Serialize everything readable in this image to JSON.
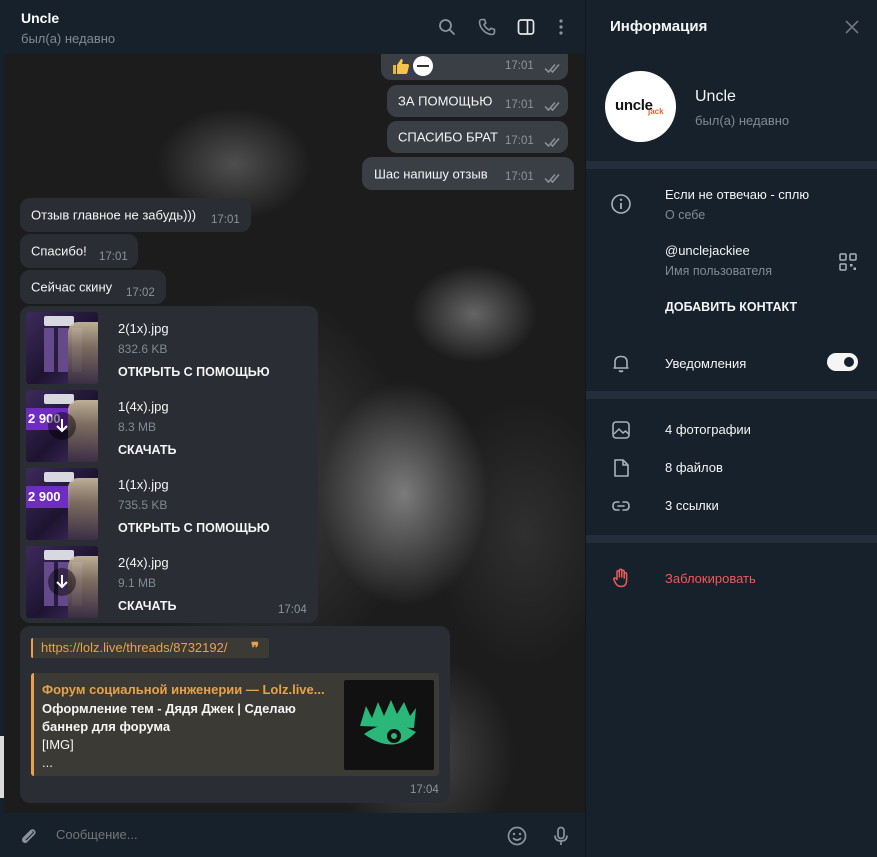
{
  "header": {
    "title": "Uncle",
    "status": "был(а) недавно"
  },
  "messages": {
    "outgoing": [
      {
        "text": "",
        "time": "17:01"
      },
      {
        "text": "ЗА ПОМОЩЬЮ",
        "time": "17:01"
      },
      {
        "text": "СПАСИБО БРАТ",
        "time": "17:01"
      },
      {
        "text": "Шас напишу отзыв",
        "time": "17:01"
      }
    ],
    "incoming": [
      {
        "text": "Отзыв главное не забудь)))",
        "time": "17:01"
      },
      {
        "text": "Спасибо!",
        "time": "17:01"
      },
      {
        "text": "Сейчас скину",
        "time": "17:02"
      }
    ],
    "files": {
      "time": "17:04",
      "items": [
        {
          "name": "2(1x).jpg",
          "size": "832.6 KB",
          "action": "ОТКРЫТЬ С ПОМОЩЬЮ",
          "price": ""
        },
        {
          "name": "1(4x).jpg",
          "size": "8.3 MB",
          "action": "СКАЧАТЬ",
          "price": "2 900"
        },
        {
          "name": "1(1x).jpg",
          "size": "735.5 KB",
          "action": "ОТКРЫТЬ С ПОМОЩЬЮ",
          "price": "2 900"
        },
        {
          "name": "2(4x).jpg",
          "size": "9.1 MB",
          "action": "СКАЧАТЬ",
          "price": ""
        }
      ]
    },
    "link": {
      "url": "https://lolz.live/threads/8732192/",
      "quote_glyph": "❞",
      "site_name": "Форум социальной инженерии — Lolz.live...",
      "desc_line1": "Оформление тем - Дядя Джек | Сделаю",
      "desc_line2": "баннер для форума",
      "desc_line3": "[IMG]",
      "desc_line4": "...",
      "time": "17:04"
    }
  },
  "composer": {
    "placeholder": "Сообщение..."
  },
  "info": {
    "title": "Информация",
    "name": "Uncle",
    "status": "был(а) недавно",
    "avatar_text": "uncle",
    "avatar_sub": "jack",
    "bio": "Если не отвечаю - сплю",
    "bio_label": "О себе",
    "username": "@unclejackiee",
    "username_label": "Имя пользователя",
    "add_contact": "ДОБАВИТЬ КОНТАКТ",
    "notifications": "Уведомления",
    "notifications_on": true,
    "photos": "4 фотографии",
    "files": "8 файлов",
    "links": "3 ссылки",
    "block": "Заблокировать"
  },
  "colors": {
    "accent": "#e8a24b",
    "danger": "#ec5b5b",
    "panel_bg": "#17212b",
    "bubble_out": "#3a3e45",
    "bubble_in": "#2a2d33"
  },
  "icons": [
    "search-icon",
    "phone-icon",
    "sidebar-icon",
    "more-icon",
    "close-icon",
    "info-icon",
    "qr-icon",
    "bell-icon",
    "photo-icon",
    "file-icon",
    "link-icon",
    "hand-icon",
    "attach-icon",
    "emoji-icon",
    "mic-icon",
    "double-check-icon",
    "download-icon",
    "thumbs-up-icon"
  ]
}
